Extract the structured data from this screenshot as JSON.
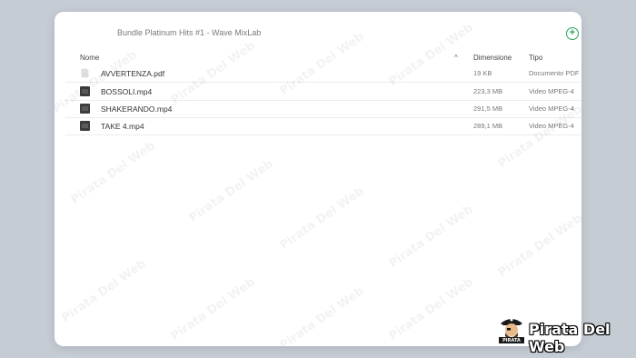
{
  "window": {
    "title": "Bundle Platinum Hits #1 - Wave MixLab"
  },
  "table": {
    "headers": {
      "name": "Nome",
      "size": "Dimensione",
      "type": "Tipo"
    },
    "sort_indicator": "^",
    "rows": [
      {
        "name": "AVVERTENZA.pdf",
        "size": "19 KB",
        "type": "Documento PDF",
        "icon": "pdf-file-icon"
      },
      {
        "name": "BOSSOLI.mp4",
        "size": "223,3 MB",
        "type": "Video MPEG-4",
        "icon": "video-file-icon"
      },
      {
        "name": "SHAKERANDO.mp4",
        "size": "291,5 MB",
        "type": "Video MPEG-4",
        "icon": "video-file-icon"
      },
      {
        "name": "TAKE 4.mp4",
        "size": "289,1 MB",
        "type": "Video MPEG-4",
        "icon": "video-file-icon"
      }
    ]
  },
  "watermark": {
    "text": "Pirata Del Web"
  },
  "brand": {
    "name": "Pirata Del Web",
    "emblem_text": "PIRATA"
  },
  "colors": {
    "accent": "#27a35a",
    "background": "#c5ccd4"
  }
}
